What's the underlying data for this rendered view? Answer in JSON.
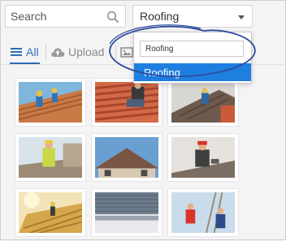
{
  "search": {
    "placeholder": "Search"
  },
  "category_select": {
    "value": "Roofing",
    "filter_value": "Roofing"
  },
  "category_options": [
    {
      "label": "Roofing",
      "highlighted": true
    }
  ],
  "tabs": [
    {
      "label": "All",
      "icon": "list-icon",
      "active": true
    },
    {
      "label": "Upload",
      "icon": "cloud-upload-icon",
      "active": false
    },
    {
      "label": "",
      "icon": "image-icon",
      "active": false
    }
  ],
  "images": [
    {
      "alt": "roofer working on clay tile roof"
    },
    {
      "alt": "roofer on terracotta tiles"
    },
    {
      "alt": "roofer in helmet on shingles"
    },
    {
      "alt": "worker in high-vis vest on roof"
    },
    {
      "alt": "house roof on blue sky"
    },
    {
      "alt": "roofer in red hard hat"
    },
    {
      "alt": "roof at sunset"
    },
    {
      "alt": "metal roof gutter detail"
    },
    {
      "alt": "worker on ladder with sky background"
    }
  ],
  "colors": {
    "accent": "#2c6db5",
    "highlight": "#1e7fe0",
    "annotation": "#2f4c9e"
  }
}
